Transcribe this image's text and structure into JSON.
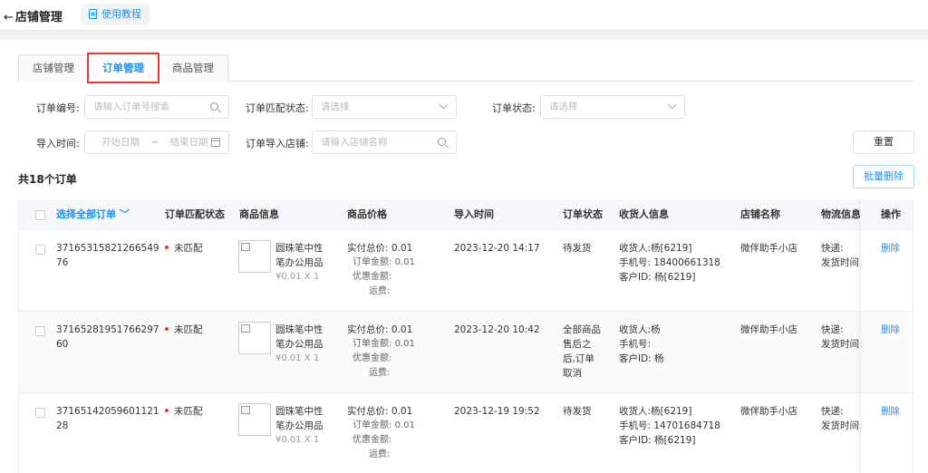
{
  "header": {
    "back_label": "店铺管理",
    "tutorial_label": "使用教程"
  },
  "tabs": [
    {
      "label": "店铺管理"
    },
    {
      "label": "订单管理",
      "active": true
    },
    {
      "label": "商品管理"
    }
  ],
  "filters": {
    "order_no_label": "订单编号:",
    "order_no_placeholder": "请输入订单号搜索",
    "match_status_label": "订单匹配状态:",
    "match_status_placeholder": "请选择",
    "order_status_label": "订单状态:",
    "order_status_placeholder": "请选择",
    "import_time_label": "导入时间:",
    "start_placeholder": "开始日期",
    "range_sep": "~",
    "end_placeholder": "结束日期",
    "shop_label": "订单导入店铺:",
    "shop_placeholder": "请输入店铺名称",
    "reset_label": "重置",
    "batch_delete_label": "批量删除"
  },
  "total_label": "共18个订单",
  "table": {
    "columns": [
      "选择全部订单",
      "订单匹配状态",
      "商品信息",
      "商品价格",
      "导入时间",
      "订单状态",
      "收货人信息",
      "店铺名称",
      "物流信息",
      "操作"
    ],
    "rows": [
      {
        "order_no_1": "37165315821266549",
        "order_no_2": "76",
        "match": "未匹配",
        "product_1": "圆珠笔中性",
        "product_2": "笔办公用品",
        "product_price": "¥0.01 X 1",
        "paid_label": "实付总价:",
        "paid": "0.01",
        "order_amt_label": "订单金额:",
        "order_amt": "0.01",
        "discount_label": "优惠金额:",
        "shipping_label": "运费:",
        "import_time": "2023-12-20 14:17",
        "status_lines": [
          "待发货"
        ],
        "receiver_name": "收货人:杨[6219]",
        "receiver_phone": "手机号: 18400661318",
        "customer_id": "客户ID: 杨[6219]",
        "shop": "微伴助手小店",
        "express": "快递:",
        "ship_time": "发货时间:",
        "action": "删除"
      },
      {
        "order_no_1": "37165281951766297",
        "order_no_2": "60",
        "match": "未匹配",
        "product_1": "圆珠笔中性",
        "product_2": "笔办公用品",
        "product_price": "¥0.01 X 1",
        "paid_label": "实付总价:",
        "paid": "0.01",
        "order_amt_label": "订单金额:",
        "order_amt": "0.01",
        "discount_label": "优惠金额:",
        "shipping_label": "运费:",
        "import_time": "2023-12-20 10:42",
        "status_lines": [
          "全部商品",
          "售后之",
          "后,订单",
          "取消"
        ],
        "receiver_name": "收货人:杨",
        "receiver_phone": "手机号:",
        "customer_id": "客户ID: 杨",
        "shop": "微伴助手小店",
        "express": "快递:",
        "ship_time": "发货时间:",
        "action": "删除"
      },
      {
        "order_no_1": "37165142059601121",
        "order_no_2": "28",
        "match": "未匹配",
        "product_1": "圆珠笔中性",
        "product_2": "笔办公用品",
        "product_price": "¥0.01 X 1",
        "paid_label": "实付总价:",
        "paid": "0.01",
        "order_amt_label": "订单金额:",
        "order_amt": "0.01",
        "discount_label": "优惠金额:",
        "shipping_label": "运费:",
        "import_time": "2023-12-19 19:52",
        "status_lines": [
          "待发货"
        ],
        "receiver_name": "收货人:杨[6219]",
        "receiver_phone": "手机号: 14701684718",
        "customer_id": "客户ID: 杨[6219]",
        "shop": "微伴助手小店",
        "express": "快递:",
        "ship_time": "发货时间:",
        "action": "删除"
      }
    ]
  }
}
